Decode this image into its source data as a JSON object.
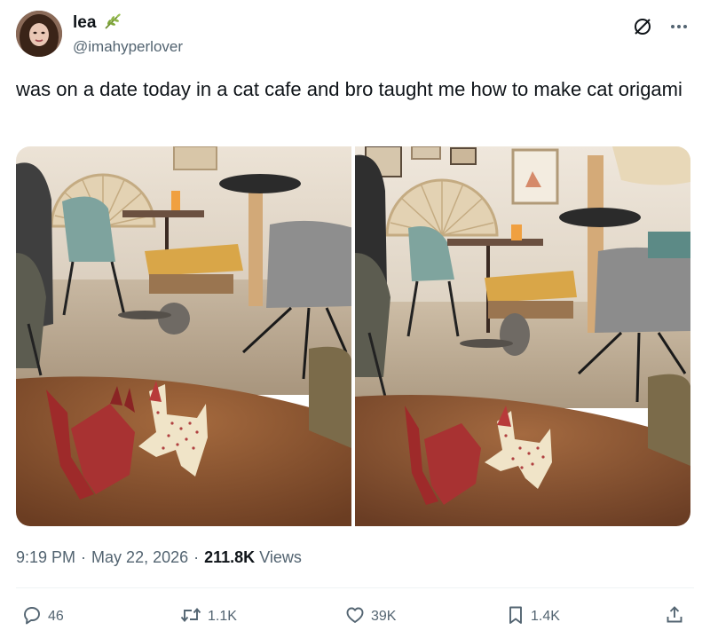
{
  "author": {
    "display_name": "lea",
    "handle": "@imahyperlover",
    "emoji_icon": "leaf-branch-icon"
  },
  "tweet": {
    "text": "was on a date today in a cat cafe and bro taught me how to make cat origami"
  },
  "media": {
    "images": [
      {
        "name": "cat-cafe-photo-left"
      },
      {
        "name": "cat-cafe-photo-right"
      }
    ]
  },
  "meta": {
    "time": "9:19 PM",
    "separator": "·",
    "date": "May 22, 2026",
    "views_count": "211.8K",
    "views_label": "Views"
  },
  "actions": {
    "replies": "46",
    "reposts": "1.1K",
    "likes": "39K",
    "bookmarks": "1.4K"
  },
  "colors": {
    "text_primary": "#0f1419",
    "text_secondary": "#536471",
    "divider": "#eff3f4"
  }
}
